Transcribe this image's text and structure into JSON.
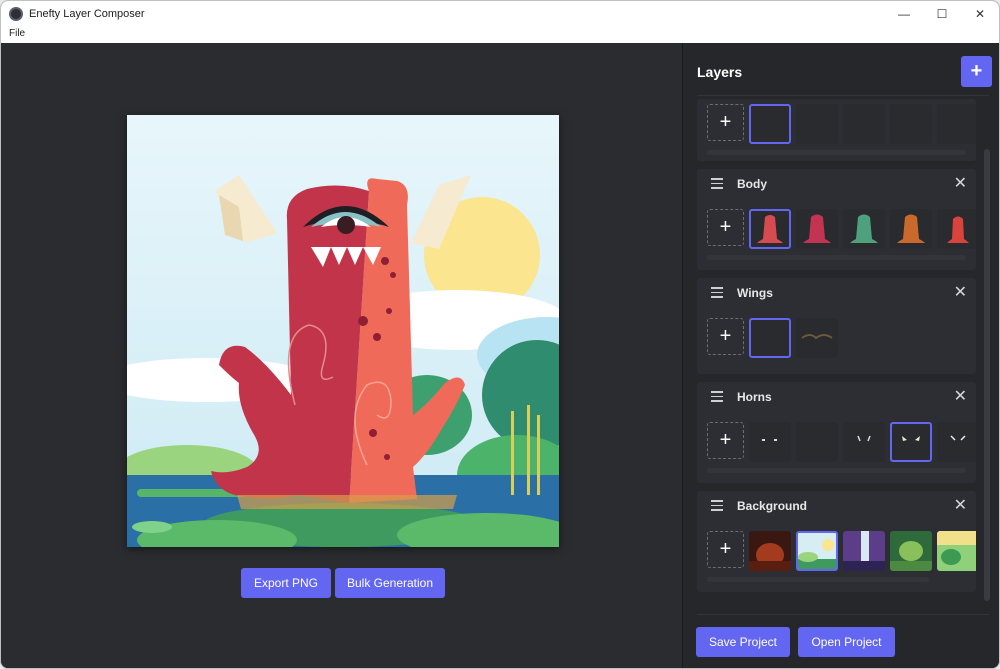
{
  "window": {
    "title": "Enefty Layer Composer",
    "minimize": "—",
    "maximize": "☐",
    "close": "✕"
  },
  "menu": {
    "file": "File"
  },
  "preview": {
    "export_label": "Export PNG",
    "bulk_label": "Bulk Generation"
  },
  "layers_panel": {
    "title": "Layers",
    "add_layer": "+",
    "layers": [
      {
        "name": "",
        "add": "+"
      },
      {
        "name": "Body",
        "add": "+",
        "close": "✕"
      },
      {
        "name": "Wings",
        "add": "+",
        "close": "✕"
      },
      {
        "name": "Horns",
        "add": "+",
        "close": "✕"
      },
      {
        "name": "Background",
        "add": "+",
        "close": "✕"
      }
    ]
  },
  "footer": {
    "save_label": "Save Project",
    "open_label": "Open Project"
  },
  "colors": {
    "accent": "#6366f1",
    "panel": "#26272b",
    "card": "#2d2e33"
  }
}
